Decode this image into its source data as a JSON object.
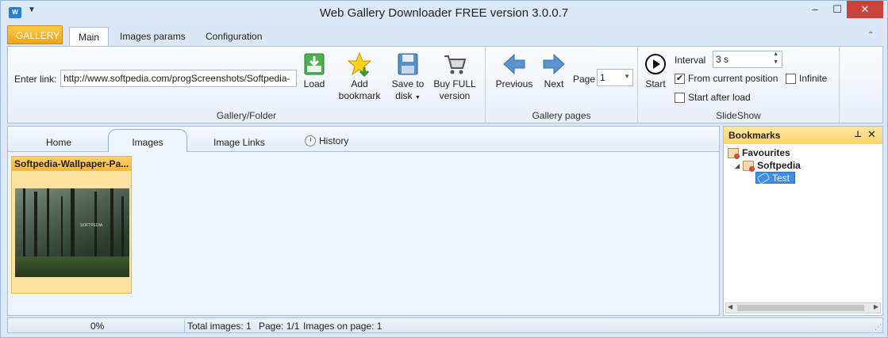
{
  "window": {
    "title": "Web Gallery Downloader FREE version 3.0.0.7",
    "minimize": "‒",
    "maximize": "☐",
    "close": "✕"
  },
  "ribbon_tabs": {
    "gallery": "GALLERY",
    "main": "Main",
    "images_params": "Images params",
    "configuration": "Configuration"
  },
  "gallery_group": {
    "label": "Gallery/Folder",
    "enter_link_label": "Enter link:",
    "link_value": "http://www.softpedia.com/progScreenshots/Softpedia-",
    "load": "Load",
    "add_bookmark": "Add bookmark",
    "save_to_disk": "Save to disk",
    "buy_full": "Buy FULL version"
  },
  "pages_group": {
    "label": "Gallery pages",
    "previous": "Previous",
    "next": "Next",
    "page_label": "Page",
    "page_value": "1"
  },
  "slideshow_group": {
    "label": "SlideShow",
    "start": "Start",
    "interval_label": "Interval",
    "interval_value": "3 s",
    "from_current": "From current position",
    "from_current_checked": "✔",
    "infinite": "Infinite",
    "start_after_load": "Start after load"
  },
  "doc_tabs": {
    "home": "Home",
    "images": "Images",
    "image_links": "Image Links",
    "history": "History"
  },
  "thumbnail": {
    "title": "Softpedia-Wallpaper-Pa...",
    "watermark": "SOFTPEDIA"
  },
  "bookmarks": {
    "title": "Bookmarks",
    "favourites": "Favourites",
    "softpedia": "Softpedia",
    "test": "Test"
  },
  "status": {
    "progress": "0%",
    "total_images": "Total images: 1",
    "page": "Page: 1/1",
    "images_on_page": "Images on page: 1"
  },
  "colors": {
    "gallery_tab": "#f0a316",
    "bookmarks_header": "#fbd46a",
    "selection": "#3d8ee6",
    "close_button": "#c9443b"
  }
}
